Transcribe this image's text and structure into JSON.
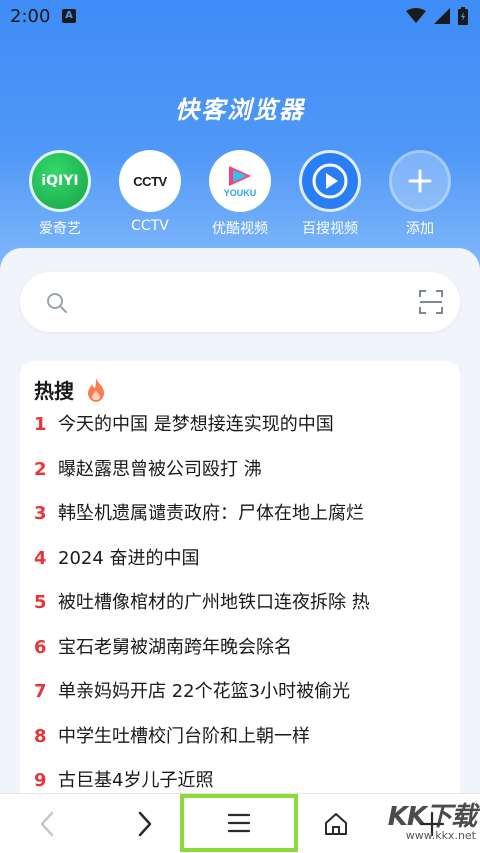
{
  "status_bar": {
    "time": "2:00",
    "notification_letter": "A"
  },
  "app_title": "快客浏览器",
  "shortcuts": [
    {
      "label": "爱奇艺",
      "logo_text": "iQIYI",
      "icon": "iqiyi-logo"
    },
    {
      "label": "CCTV",
      "logo_text": "CCTV",
      "icon": "cctv-logo"
    },
    {
      "label": "优酷视频",
      "logo_text": "YOUKU",
      "icon": "youku-logo"
    },
    {
      "label": "百搜视频",
      "icon": "baisou-play-logo"
    },
    {
      "label": "添加",
      "icon": "plus-icon"
    }
  ],
  "search": {
    "placeholder": "",
    "value": ""
  },
  "hot_search": {
    "title": "热搜",
    "items": [
      {
        "rank": "1",
        "text": "今天的中国 是梦想接连实现的中国"
      },
      {
        "rank": "2",
        "text": "曝赵露思曾被公司殴打  沸"
      },
      {
        "rank": "3",
        "text": "韩坠机遗属谴责政府：尸体在地上腐烂"
      },
      {
        "rank": "4",
        "text": "2024 奋进的中国"
      },
      {
        "rank": "5",
        "text": "被吐槽像棺材的广州地铁口连夜拆除  热"
      },
      {
        "rank": "6",
        "text": "宝石老舅被湖南跨年晚会除名"
      },
      {
        "rank": "7",
        "text": "单亲妈妈开店 22个花篮3小时被偷光"
      },
      {
        "rank": "8",
        "text": "中学生吐槽校门台阶和上朝一样"
      },
      {
        "rank": "9",
        "text": "古巨基4岁儿子近照"
      }
    ]
  },
  "bottom_nav": [
    "back-icon",
    "forward-icon",
    "menu-icon",
    "home-icon",
    "new-tab-icon"
  ],
  "watermark": {
    "logo": "KK下载",
    "url": "www.kkx.net"
  },
  "colors": {
    "primary": "#4f98f7",
    "rank_red": "#e8353b",
    "highlight_green": "#8cd93a"
  }
}
